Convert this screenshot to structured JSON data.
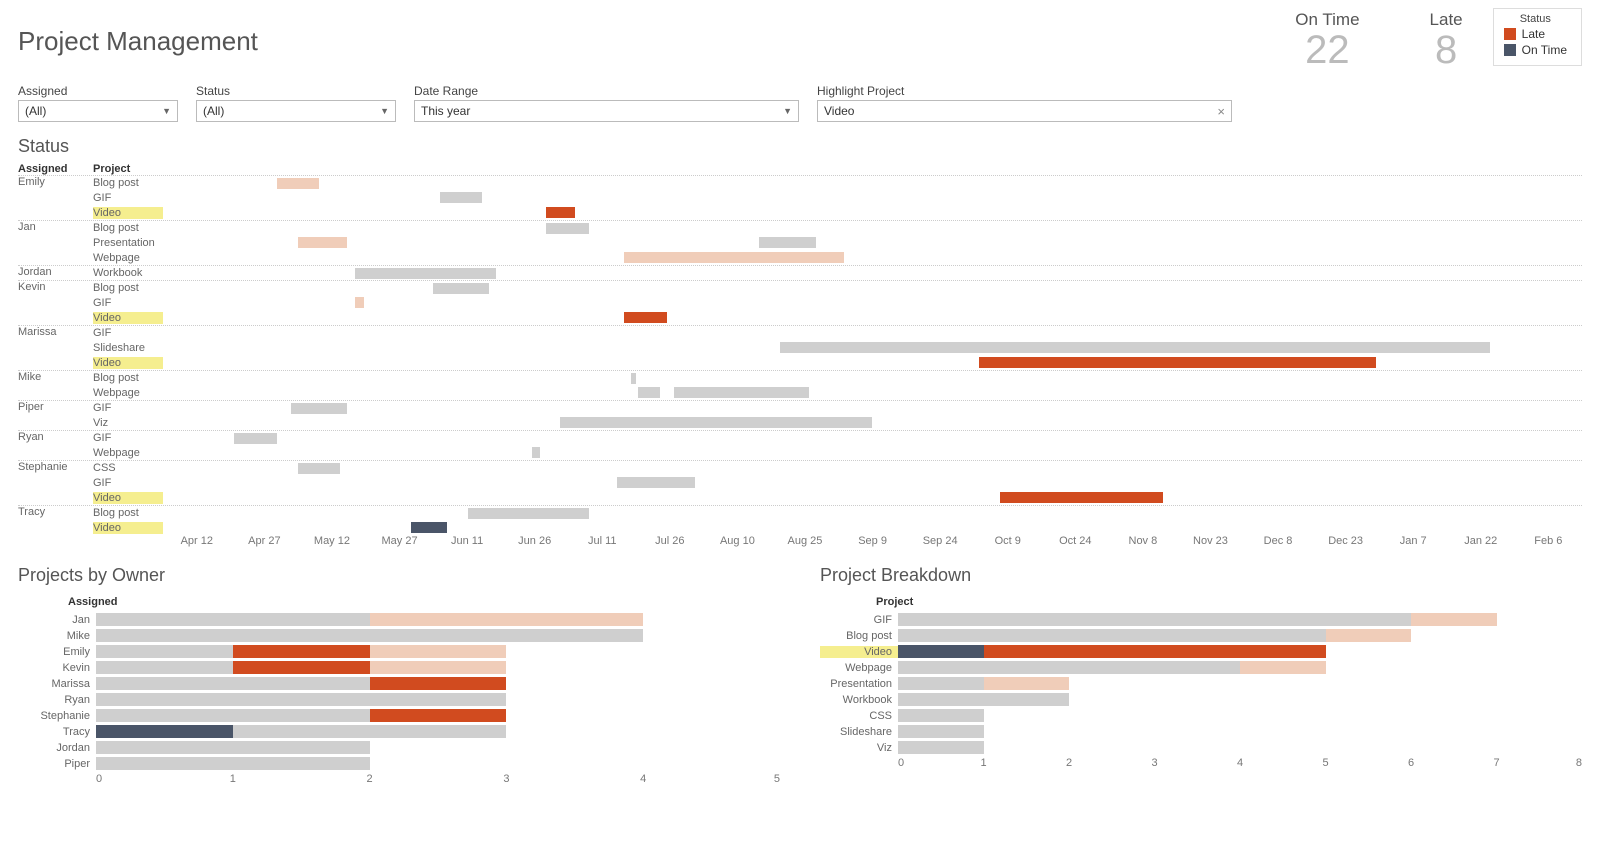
{
  "title": "Project Management",
  "kpis": {
    "ontime": {
      "label": "On Time",
      "value": "22"
    },
    "late": {
      "label": "Late",
      "value": "8"
    }
  },
  "legend": {
    "title": "Status",
    "items": [
      {
        "label": "Late",
        "color": "#d14b1f"
      },
      {
        "label": "On Time",
        "color": "#4a5568"
      }
    ]
  },
  "filters": {
    "assigned": {
      "label": "Assigned",
      "value": "(All)"
    },
    "status": {
      "label": "Status",
      "value": "(All)"
    },
    "date": {
      "label": "Date Range",
      "value": "This year"
    },
    "highlight": {
      "label": "Highlight Project",
      "value": "Video"
    }
  },
  "gantt": {
    "title": "Status",
    "cols": {
      "assigned": "Assigned",
      "project": "Project"
    },
    "ticks": [
      "Apr 12",
      "Apr 27",
      "May 12",
      "May 27",
      "Jun 11",
      "Jun 26",
      "Jul 11",
      "Jul 26",
      "Aug 10",
      "Aug 25",
      "Sep 9",
      "Sep 24",
      "Oct 9",
      "Oct 24",
      "Nov 8",
      "Nov 23",
      "Dec 8",
      "Dec 23",
      "Jan 7",
      "Jan 22",
      "Feb 6"
    ]
  },
  "owners_title": "Projects by Owner",
  "breakdown_title": "Project Breakdown",
  "owners_header": "Assigned",
  "breakdown_header": "Project",
  "chart_data": {
    "gantt": {
      "type": "gantt",
      "xrange_pct": [
        0,
        100
      ],
      "ticks_count": 21,
      "rows": [
        {
          "assigned": "Emily",
          "project": "Blog post",
          "hl": false,
          "bars": [
            {
              "s": 8,
              "e": 11,
              "c": "c-peach"
            }
          ]
        },
        {
          "assigned": "",
          "project": "GIF",
          "hl": false,
          "bars": [
            {
              "s": 19.5,
              "e": 22.5,
              "c": "c-gray"
            }
          ]
        },
        {
          "assigned": "",
          "project": "Video",
          "hl": true,
          "bars": [
            {
              "s": 27,
              "e": 29,
              "c": "c-late"
            }
          ]
        },
        {
          "assigned": "Jan",
          "project": "Blog post",
          "hl": false,
          "bars": [
            {
              "s": 27,
              "e": 30,
              "c": "c-gray"
            }
          ]
        },
        {
          "assigned": "",
          "project": "Presentation",
          "hl": false,
          "bars": [
            {
              "s": 9.5,
              "e": 13,
              "c": "c-peach"
            },
            {
              "s": 42,
              "e": 46,
              "c": "c-gray"
            }
          ]
        },
        {
          "assigned": "",
          "project": "Webpage",
          "hl": false,
          "bars": [
            {
              "s": 32.5,
              "e": 48,
              "c": "c-peach"
            }
          ]
        },
        {
          "assigned": "Jordan",
          "project": "Workbook",
          "hl": false,
          "bars": [
            {
              "s": 13.5,
              "e": 23.5,
              "c": "c-gray"
            }
          ]
        },
        {
          "assigned": "Kevin",
          "project": "Blog post",
          "hl": false,
          "bars": [
            {
              "s": 19,
              "e": 23,
              "c": "c-gray"
            }
          ]
        },
        {
          "assigned": "",
          "project": "GIF",
          "hl": false,
          "bars": [
            {
              "s": 13.5,
              "e": 14.2,
              "c": "c-peach"
            }
          ]
        },
        {
          "assigned": "",
          "project": "Video",
          "hl": true,
          "bars": [
            {
              "s": 32.5,
              "e": 35.5,
              "c": "c-late"
            }
          ]
        },
        {
          "assigned": "Marissa",
          "project": "GIF",
          "hl": false,
          "bars": []
        },
        {
          "assigned": "",
          "project": "Slideshare",
          "hl": false,
          "bars": [
            {
              "s": 43.5,
              "e": 93.5,
              "c": "c-gray"
            }
          ]
        },
        {
          "assigned": "",
          "project": "Video",
          "hl": true,
          "bars": [
            {
              "s": 57.5,
              "e": 85.5,
              "c": "c-late"
            }
          ]
        },
        {
          "assigned": "Mike",
          "project": "Blog post",
          "hl": false,
          "bars": [
            {
              "s": 33,
              "e": 33.3,
              "c": "c-gray"
            }
          ]
        },
        {
          "assigned": "",
          "project": "Webpage",
          "hl": false,
          "bars": [
            {
              "s": 33.5,
              "e": 35,
              "c": "c-gray"
            },
            {
              "s": 36,
              "e": 45.5,
              "c": "c-gray"
            }
          ]
        },
        {
          "assigned": "Piper",
          "project": "GIF",
          "hl": false,
          "bars": [
            {
              "s": 9,
              "e": 13,
              "c": "c-gray"
            }
          ]
        },
        {
          "assigned": "",
          "project": "Viz",
          "hl": false,
          "bars": [
            {
              "s": 28,
              "e": 50,
              "c": "c-gray"
            }
          ]
        },
        {
          "assigned": "Ryan",
          "project": "GIF",
          "hl": false,
          "bars": [
            {
              "s": 5,
              "e": 8,
              "c": "c-gray"
            }
          ]
        },
        {
          "assigned": "",
          "project": "Webpage",
          "hl": false,
          "bars": [
            {
              "s": 26,
              "e": 26.6,
              "c": "c-gray"
            }
          ]
        },
        {
          "assigned": "Stephanie",
          "project": "CSS",
          "hl": false,
          "bars": [
            {
              "s": 9.5,
              "e": 12.5,
              "c": "c-gray"
            }
          ]
        },
        {
          "assigned": "",
          "project": "GIF",
          "hl": false,
          "bars": [
            {
              "s": 32,
              "e": 37.5,
              "c": "c-gray"
            }
          ]
        },
        {
          "assigned": "",
          "project": "Video",
          "hl": true,
          "bars": [
            {
              "s": 59,
              "e": 70.5,
              "c": "c-late"
            }
          ]
        },
        {
          "assigned": "Tracy",
          "project": "Blog post",
          "hl": false,
          "bars": [
            {
              "s": 21.5,
              "e": 30,
              "c": "c-gray"
            }
          ]
        },
        {
          "assigned": "",
          "project": "Video",
          "hl": true,
          "bars": [
            {
              "s": 17.5,
              "e": 20,
              "c": "c-ontime"
            }
          ]
        }
      ]
    },
    "owners": {
      "type": "bar",
      "max": 5,
      "ticks": [
        0,
        1,
        2,
        3,
        4,
        5
      ],
      "rows": [
        {
          "name": "Jan",
          "hl": false,
          "segs": [
            {
              "v": 2,
              "c": "c-gray"
            },
            {
              "v": 2,
              "c": "c-peach"
            }
          ]
        },
        {
          "name": "Mike",
          "hl": false,
          "segs": [
            {
              "v": 4,
              "c": "c-gray"
            }
          ]
        },
        {
          "name": "Emily",
          "hl": false,
          "segs": [
            {
              "v": 1,
              "c": "c-gray"
            },
            {
              "v": 1,
              "c": "c-late"
            },
            {
              "v": 1,
              "c": "c-peach"
            }
          ]
        },
        {
          "name": "Kevin",
          "hl": false,
          "segs": [
            {
              "v": 1,
              "c": "c-gray"
            },
            {
              "v": 1,
              "c": "c-late"
            },
            {
              "v": 1,
              "c": "c-peach"
            }
          ]
        },
        {
          "name": "Marissa",
          "hl": false,
          "segs": [
            {
              "v": 2,
              "c": "c-gray"
            },
            {
              "v": 1,
              "c": "c-late"
            }
          ]
        },
        {
          "name": "Ryan",
          "hl": false,
          "segs": [
            {
              "v": 3,
              "c": "c-gray"
            }
          ]
        },
        {
          "name": "Stephanie",
          "hl": false,
          "segs": [
            {
              "v": 2,
              "c": "c-gray"
            },
            {
              "v": 1,
              "c": "c-late"
            }
          ]
        },
        {
          "name": "Tracy",
          "hl": false,
          "segs": [
            {
              "v": 1,
              "c": "c-ontime"
            },
            {
              "v": 2,
              "c": "c-gray"
            }
          ]
        },
        {
          "name": "Jordan",
          "hl": false,
          "segs": [
            {
              "v": 2,
              "c": "c-gray"
            }
          ]
        },
        {
          "name": "Piper",
          "hl": false,
          "segs": [
            {
              "v": 2,
              "c": "c-gray"
            }
          ]
        }
      ]
    },
    "breakdown": {
      "type": "bar",
      "max": 8,
      "ticks": [
        0,
        1,
        2,
        3,
        4,
        5,
        6,
        7,
        8
      ],
      "rows": [
        {
          "name": "GIF",
          "hl": false,
          "segs": [
            {
              "v": 6,
              "c": "c-gray"
            },
            {
              "v": 1,
              "c": "c-peach"
            }
          ]
        },
        {
          "name": "Blog post",
          "hl": false,
          "segs": [
            {
              "v": 5,
              "c": "c-gray"
            },
            {
              "v": 1,
              "c": "c-peach"
            }
          ]
        },
        {
          "name": "Video",
          "hl": true,
          "segs": [
            {
              "v": 1,
              "c": "c-ontime"
            },
            {
              "v": 4,
              "c": "c-late"
            }
          ]
        },
        {
          "name": "Webpage",
          "hl": false,
          "segs": [
            {
              "v": 4,
              "c": "c-gray"
            },
            {
              "v": 1,
              "c": "c-peach"
            }
          ]
        },
        {
          "name": "Presentation",
          "hl": false,
          "segs": [
            {
              "v": 1,
              "c": "c-gray"
            },
            {
              "v": 1,
              "c": "c-peach"
            }
          ]
        },
        {
          "name": "Workbook",
          "hl": false,
          "segs": [
            {
              "v": 2,
              "c": "c-gray"
            }
          ]
        },
        {
          "name": "CSS",
          "hl": false,
          "segs": [
            {
              "v": 1,
              "c": "c-gray"
            }
          ]
        },
        {
          "name": "Slideshare",
          "hl": false,
          "segs": [
            {
              "v": 1,
              "c": "c-gray"
            }
          ]
        },
        {
          "name": "Viz",
          "hl": false,
          "segs": [
            {
              "v": 1,
              "c": "c-gray"
            }
          ]
        }
      ]
    }
  }
}
